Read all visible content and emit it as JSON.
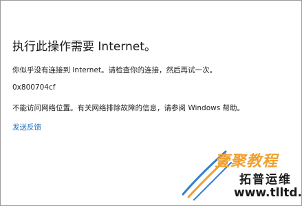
{
  "dialog": {
    "heading": "执行此操作需要 Internet。",
    "message_1": "你似乎没有连接到 Internet。请检查你的连接，然后再试一次。",
    "error_code": "0x800704cf",
    "message_2": "不能访问网络位置。有关网络排除故障的信息，请参阅 Windows 帮助。",
    "feedback_link": "发送反馈"
  },
  "watermark": {
    "brand": "壹聚教程",
    "subtitle": "拓普运维",
    "url": "www.tlltd.cn"
  }
}
